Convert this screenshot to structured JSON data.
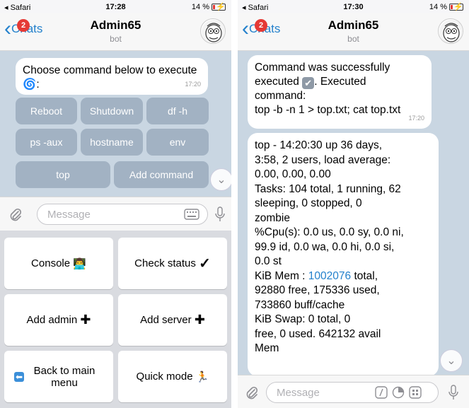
{
  "left": {
    "status": {
      "carrier": "◂ Safari",
      "time": "17:28",
      "battery": "14 %"
    },
    "nav": {
      "back_label": "Chats",
      "badge": "2",
      "title": "Admin65",
      "subtitle": "bot"
    },
    "message": {
      "text": "Choose command below to execute",
      "emoji": "🌀",
      "suffix": ":",
      "time": "17:20"
    },
    "inline_keyboard": {
      "row1": [
        "Reboot",
        "Shutdown",
        "df -h"
      ],
      "row2": [
        "ps -aux",
        "hostname",
        "env"
      ],
      "row3": [
        "top",
        "Add command"
      ]
    },
    "input": {
      "placeholder": "Message"
    },
    "reply_keyboard": [
      {
        "label": "Console",
        "emoji": "👨‍💻"
      },
      {
        "label": "Check status",
        "emoji": "✓"
      },
      {
        "label": "Add admin",
        "emoji": "✚"
      },
      {
        "label": "Add server",
        "emoji": "✚"
      },
      {
        "label": "Back to main menu",
        "emoji": "⬅"
      },
      {
        "label": "Quick mode",
        "emoji": "🏃"
      }
    ]
  },
  "right": {
    "status": {
      "carrier": "◂ Safari",
      "time": "17:30",
      "battery": "14 %"
    },
    "nav": {
      "back_label": "Chats",
      "badge": "2",
      "title": "Admin65",
      "subtitle": "bot"
    },
    "message1": {
      "line1": "Command was successfully",
      "line2a": "executed",
      "line2b": ". Executed",
      "line3": "command:",
      "line4": "top -b -n 1 > top.txt; cat top.txt",
      "time": "17:20"
    },
    "message2": {
      "l1": "top - 14:20:30 up 36 days,",
      "l2": "3:58,  2 users,  load average:",
      "l3": "0.00, 0.00, 0.00",
      "l4": "Tasks: 104 total,   1 running,  62",
      "l5": "sleeping,   0 stopped,   0",
      "l6": "zombie",
      "l7": "%Cpu(s):  0.0 us,  0.0 sy,  0.0 ni,",
      "l8": "99.9 id,  0.0 wa,  0.0 hi,  0.0 si,",
      "l9": "0.0 st",
      "l10a": "KiB Mem : ",
      "l10link": "1002076",
      "l10b": " total,",
      "l11": "92880 free,   175336 used,",
      "l12": "733860 buff/cache",
      "l13": "KiB Swap:        0 total,        0",
      "l14": "free,        0 used.   642132 avail",
      "l15": "Mem"
    },
    "input": {
      "placeholder": "Message"
    }
  },
  "colors": {
    "accent": "#2481cc",
    "badge": "#e53935",
    "chat_bg": "#c9d6e2"
  },
  "icons": [
    "chevron-left-icon",
    "attach-icon",
    "keyboard-icon",
    "microphone-icon",
    "chevron-down-icon",
    "check-box-icon",
    "slash-command-icon",
    "timer-icon",
    "sticker-icon",
    "bot-avatar"
  ]
}
